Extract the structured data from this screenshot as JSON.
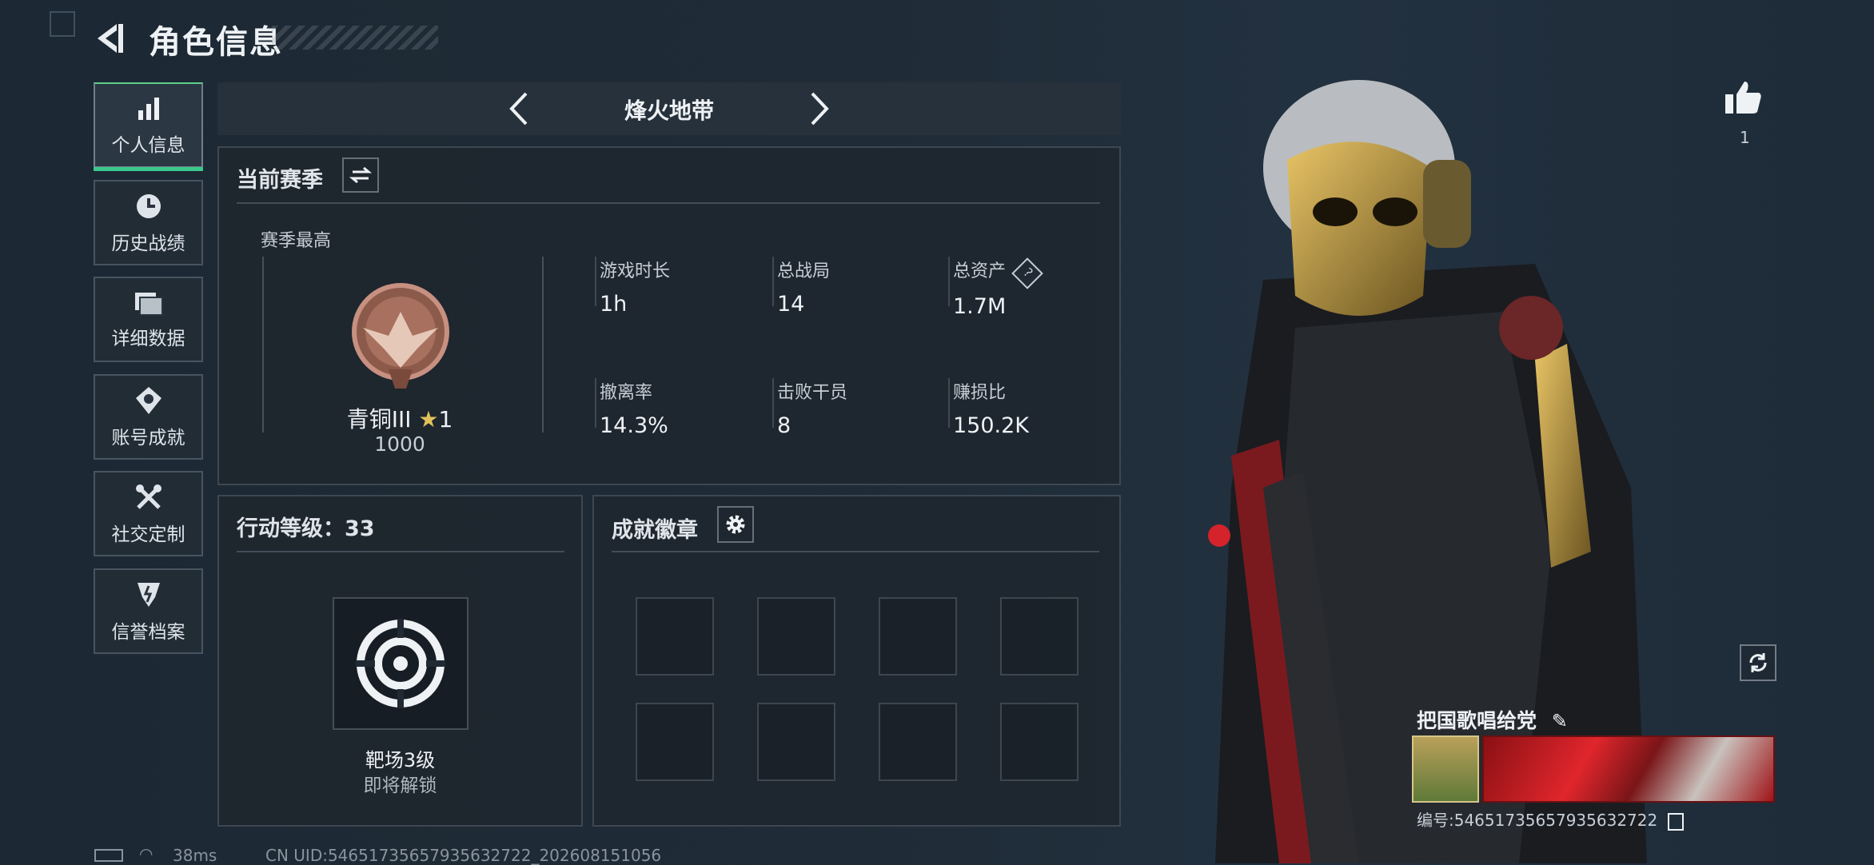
{
  "header": {
    "title": "角色信息"
  },
  "sidebar": {
    "items": [
      {
        "label": "个人信息",
        "icon": "bar-chart-icon",
        "active": true
      },
      {
        "label": "历史战绩",
        "icon": "clock-icon"
      },
      {
        "label": "详细数据",
        "icon": "folder-icon"
      },
      {
        "label": "账号成就",
        "icon": "medal-icon"
      },
      {
        "label": "社交定制",
        "icon": "tools-icon"
      },
      {
        "label": "信誉档案",
        "icon": "shield-icon"
      }
    ]
  },
  "mode_selector": {
    "label": "烽火地带"
  },
  "season": {
    "title": "当前赛季",
    "best_label": "赛季最高",
    "rank_name": "青铜III",
    "rank_stars": "1",
    "rank_score": "1000",
    "stats": [
      {
        "label": "游戏时长",
        "value": "1h"
      },
      {
        "label": "总战局",
        "value": "14"
      },
      {
        "label": "总资产",
        "value": "1.7M",
        "help": "?"
      },
      {
        "label": "撤离率",
        "value": "14.3%"
      },
      {
        "label": "击败干员",
        "value": "8"
      },
      {
        "label": "赚损比",
        "value": "150.2K"
      }
    ]
  },
  "action_level": {
    "title": "行动等级：33",
    "range_label": "靶场3级",
    "range_status": "即将解锁"
  },
  "badges": {
    "title": "成就徽章",
    "slots": 8
  },
  "likes": {
    "count": "1"
  },
  "player": {
    "name": "把国歌唱给党",
    "id_label": "编号:5465173565793563272​2"
  },
  "footer": {
    "ping": "38ms",
    "uid": "CN UID:5465173565793563272​2_202608151056"
  },
  "colors": {
    "accent_green": "#39c98a",
    "bg": "#1f2b36",
    "bronze": "#b0786a",
    "gold": "#e2c15a"
  }
}
